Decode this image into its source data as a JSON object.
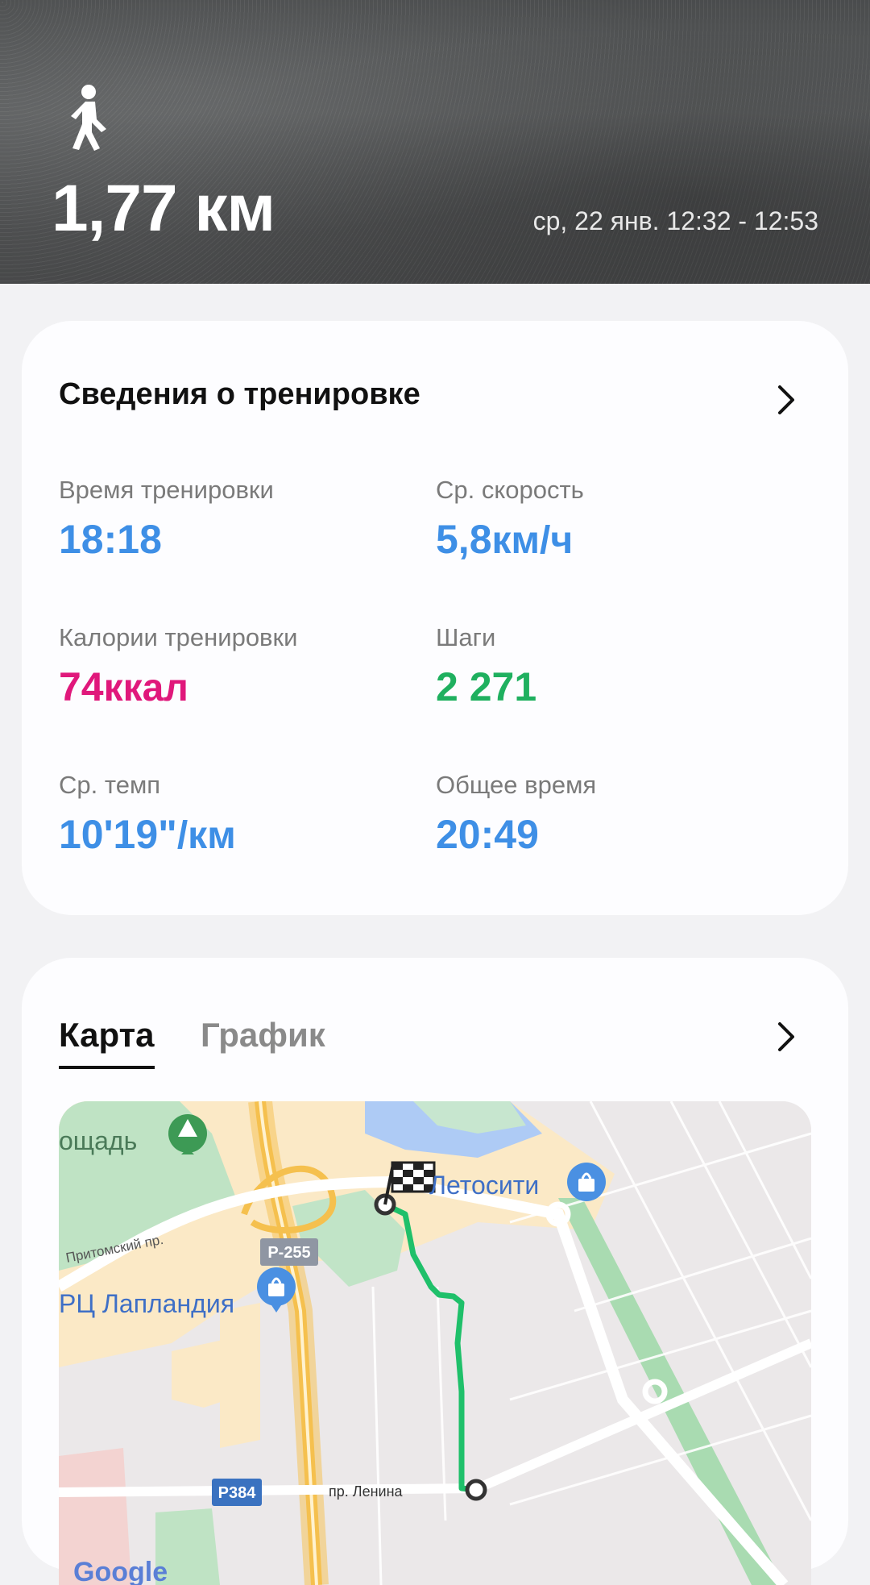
{
  "header": {
    "activity_icon": "walking-person-icon",
    "distance": "1,77 км",
    "datetime": "ср, 22 янв. 12:32 - 12:53"
  },
  "workout": {
    "title": "Сведения о тренировке",
    "stats": [
      {
        "label": "Время тренировки",
        "value": "18:18",
        "unit": "",
        "color": "#3e8fe6"
      },
      {
        "label": "Ср. скорость",
        "value": "5,8",
        "unit": "км/ч",
        "color": "#3e8fe6"
      },
      {
        "label": "Калории тренировки",
        "value": "74",
        "unit": "ккал",
        "color": "#e0187b"
      },
      {
        "label": "Шаги",
        "value": "2 271",
        "unit": "",
        "color": "#1fb05f"
      },
      {
        "label": "Ср. темп",
        "value": "10'19\"",
        "unit": "/км",
        "color": "#3e8fe6"
      },
      {
        "label": "Общее время",
        "value": "20:49",
        "unit": "",
        "color": "#3e8fe6"
      }
    ]
  },
  "map_section": {
    "tabs": [
      "Карта",
      "График"
    ],
    "active_tab": "Карта",
    "map_labels": {
      "square": "ощадь",
      "letocity": "Летосити",
      "prospect": "Притомский пр.",
      "r255": "Р-255",
      "laplandia": "РЦ Лапландия",
      "r384": "Р384",
      "lenina": "пр. Ленина",
      "google": "Google"
    }
  }
}
